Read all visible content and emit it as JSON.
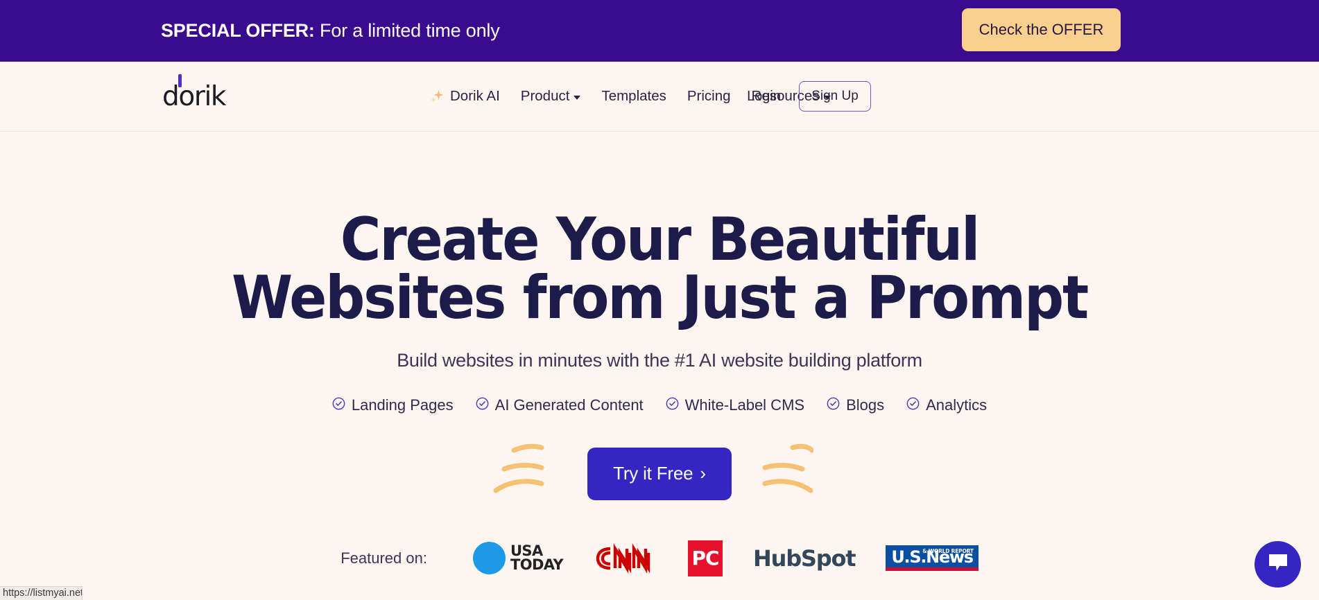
{
  "promo_banner": {
    "bold_label": "SPECIAL OFFER:",
    "message": " For a limited time only",
    "cta_label": "Check the OFFER",
    "background_color": "#3A0B8E",
    "cta_color": "#FBCF8E"
  },
  "navbar": {
    "logo_text": "dorik",
    "links": [
      {
        "label": "Dorik AI",
        "icon": "sparkle-icon",
        "has_chevron": false
      },
      {
        "label": "Product",
        "icon": null,
        "has_chevron": true
      },
      {
        "label": "Templates",
        "icon": null,
        "has_chevron": false
      },
      {
        "label": "Pricing",
        "icon": null,
        "has_chevron": false
      },
      {
        "label": "Resources",
        "icon": null,
        "has_chevron": true
      }
    ],
    "login_label": "Login",
    "signup_label": "Sign Up"
  },
  "hero": {
    "title_line1": "Create Your Beautiful",
    "title_line2": "Websites from Just a Prompt",
    "subtitle": "Build websites in minutes with the #1 AI website building platform",
    "features": [
      {
        "label": "Landing Pages",
        "icon": "check-circle-icon"
      },
      {
        "label": "AI Generated Content",
        "icon": "check-circle-icon"
      },
      {
        "label": "White-Label CMS",
        "icon": "check-circle-icon"
      },
      {
        "label": "Blogs",
        "icon": "check-circle-icon"
      },
      {
        "label": "Analytics",
        "icon": "check-circle-icon"
      }
    ],
    "cta_label": "Try it Free",
    "cta_arrow": "›",
    "cta_color": "#3526C4",
    "title_color": "#1D1B49",
    "flourish_color": "#F5C173"
  },
  "featured": {
    "label": "Featured on:",
    "logos": [
      {
        "name": "usa-today-logo",
        "line1": "USA",
        "line2": "TODAY",
        "color": "#1C9AE8"
      },
      {
        "name": "cnn-logo",
        "text": "CNN",
        "color": "#CC0000"
      },
      {
        "name": "pc-magazine-logo",
        "text": "PC",
        "color": "#E8112D"
      },
      {
        "name": "hubspot-logo",
        "text": "HubSpot",
        "color": "#33475B"
      },
      {
        "name": "us-news-logo",
        "main": "U.S.News",
        "sub": "& WORLD REPORT",
        "color": "#0B4EA2"
      }
    ]
  },
  "chat_widget": {
    "icon": "chat-bubble-icon",
    "color": "#3526C4"
  },
  "status_bar": {
    "url": "https://listmyai.net"
  }
}
